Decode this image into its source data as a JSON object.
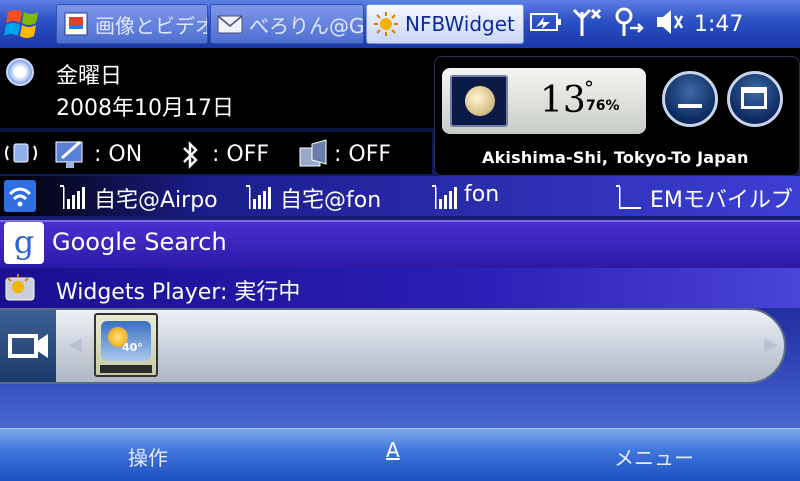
{
  "taskbar": {
    "tabs": [
      {
        "label": "画像とビデオ",
        "icon": "photos-icon",
        "active": false
      },
      {
        "label": "べろりん@Gl",
        "icon": "mail-icon",
        "active": false
      },
      {
        "label": "NFBWidget",
        "icon": "sun-widget-icon",
        "active": true
      }
    ],
    "clock": "1:47"
  },
  "today": {
    "weekday": "金曜日",
    "date": "2008年10月17日",
    "status": {
      "wifi_label": ": ON",
      "bluetooth_label": ": OFF",
      "phone_label": ": OFF"
    },
    "networks": [
      "自宅@Airpo",
      "自宅@fon",
      "fon",
      "EMモバイルブ"
    ],
    "google_search": "Google Search",
    "widgets_player": "Widgets Player: 実行中",
    "tray_left_arrow": "◀",
    "tray_right_arrow": "▶",
    "tray_widget_temp": "40°"
  },
  "weather": {
    "temperature": "13",
    "degree_symbol": "°",
    "humidity": "76%",
    "location": "Akishima-Shi, Tokyo-To Japan"
  },
  "softkeys": {
    "left": "操作",
    "center": "A",
    "right": "メニュー"
  },
  "colors": {
    "taskbar": "#2b4fc4",
    "softbar": "#3c73da",
    "google_row": "#3a23bc"
  }
}
